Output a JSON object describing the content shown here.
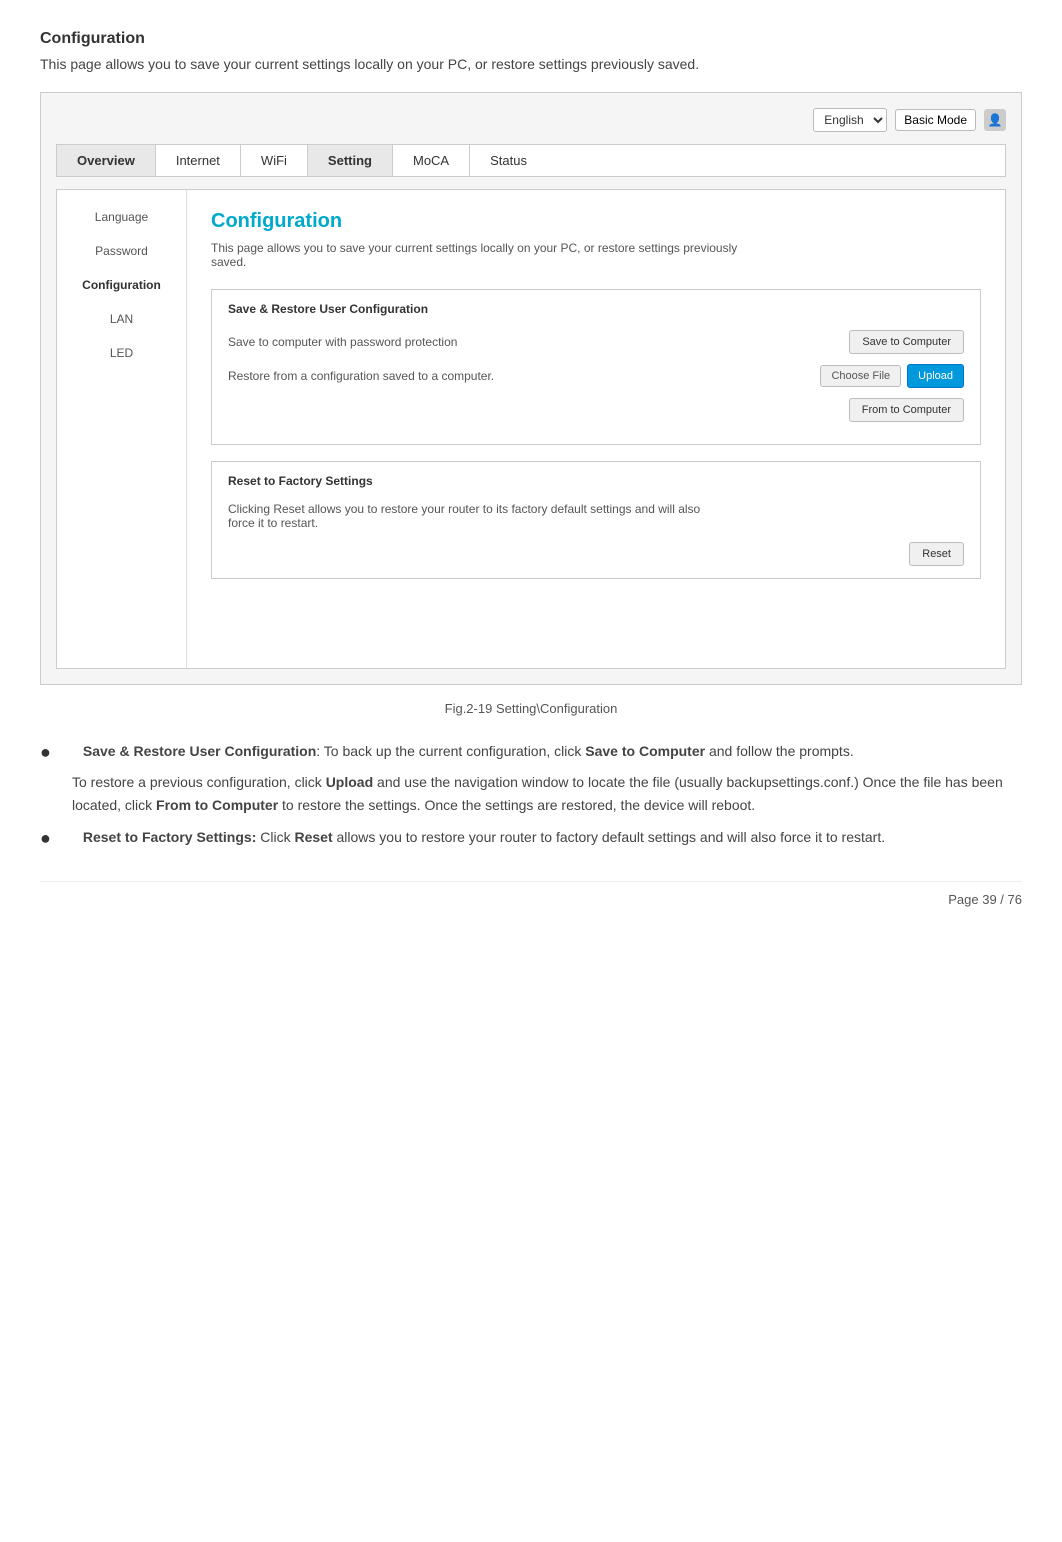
{
  "page": {
    "title": "Configuration",
    "intro": "This page allows you to save your current settings locally on your PC, or restore settings previously saved."
  },
  "router_ui": {
    "lang_select": {
      "label": "English",
      "options": [
        "English"
      ]
    },
    "basic_mode_btn": "Basic Mode",
    "nav_tabs": [
      {
        "label": "Overview",
        "active": false
      },
      {
        "label": "Internet",
        "active": false
      },
      {
        "label": "WiFi",
        "active": false
      },
      {
        "label": "Setting",
        "active": true
      },
      {
        "label": "MoCA",
        "active": false
      },
      {
        "label": "Status",
        "active": false
      }
    ],
    "sidebar": {
      "items": [
        {
          "label": "Language",
          "active": false
        },
        {
          "label": "Password",
          "active": false
        },
        {
          "label": "Configuration",
          "active": true
        },
        {
          "label": "LAN",
          "active": false
        },
        {
          "label": "LED",
          "active": false
        }
      ]
    },
    "content": {
      "heading": "Configuration",
      "description": "This page allows you to save your current settings locally on your PC, or restore settings previously saved.",
      "save_restore_section": {
        "title": "Save & Restore User Configuration",
        "rows": [
          {
            "label": "Save to computer with password protection",
            "button": "Save to Computer"
          },
          {
            "label": "Restore from a configuration saved to a computer.",
            "choose_file": "Choose File",
            "upload_btn": "Upload",
            "from_computer_btn": "From to Computer"
          }
        ]
      },
      "factory_reset_section": {
        "title": "Reset to Factory Settings",
        "description": "Clicking Reset allows you to restore your router to its factory default settings and will also force it to restart.",
        "reset_btn": "Reset"
      }
    }
  },
  "fig_caption": "Fig.2-19 Setting\\Configuration",
  "bullets": [
    {
      "label": "Save & Restore User Configuration",
      "label_suffix": ": To back up the current configuration, click ",
      "highlight1": "Save to Computer",
      "text1": " and follow the prompts.",
      "para2_pre": "To restore a previous configuration, click ",
      "highlight2": "Upload",
      "text2": " and use the navigation window to locate the file (usually backupsettings.conf.) Once the file has been located, click ",
      "highlight3": "From to Computer",
      "text3": " to restore the settings. Once the settings are restored, the device will reboot."
    },
    {
      "label": "Reset to Factory Settings:",
      "text_pre": " Click ",
      "highlight": "Reset",
      "text_post": " allows you to restore your router to factory default settings and will also force it to restart."
    }
  ],
  "footer": {
    "text": "Page 39 / 76"
  }
}
